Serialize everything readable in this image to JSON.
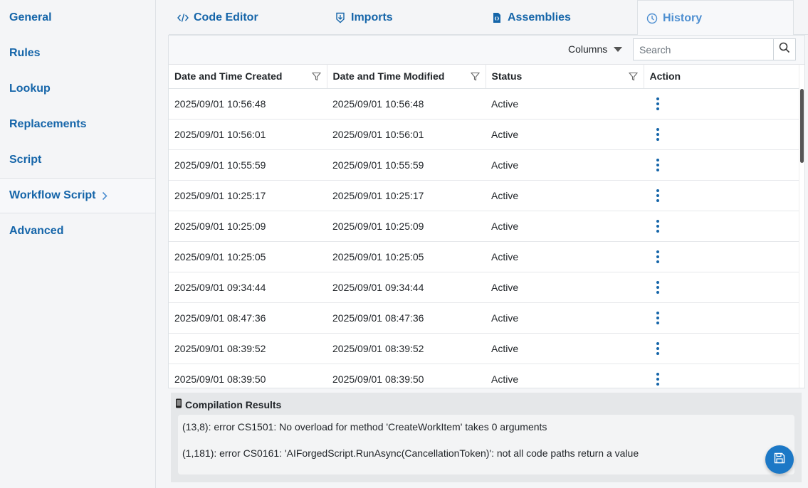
{
  "sidebar": {
    "items": [
      {
        "label": "General"
      },
      {
        "label": "Rules"
      },
      {
        "label": "Lookup"
      },
      {
        "label": "Replacements"
      },
      {
        "label": "Script"
      },
      {
        "label": "Workflow Script",
        "active": true
      },
      {
        "label": "Advanced"
      }
    ]
  },
  "tabs": [
    {
      "label": "Code Editor",
      "icon": "code-icon"
    },
    {
      "label": "Imports",
      "icon": "import-icon"
    },
    {
      "label": "Assemblies",
      "icon": "assembly-icon"
    },
    {
      "label": "History",
      "icon": "history-icon",
      "active": true
    }
  ],
  "toolbar": {
    "columns_label": "Columns",
    "search_placeholder": "Search",
    "search_value": ""
  },
  "table": {
    "headers": [
      "Date and Time Created",
      "Date and Time Modified",
      "Status",
      "Action"
    ],
    "rows": [
      [
        "2025/09/01 10:56:48",
        "2025/09/01 10:56:48",
        "Active"
      ],
      [
        "2025/09/01 10:56:01",
        "2025/09/01 10:56:01",
        "Active"
      ],
      [
        "2025/09/01 10:55:59",
        "2025/09/01 10:55:59",
        "Active"
      ],
      [
        "2025/09/01 10:25:17",
        "2025/09/01 10:25:17",
        "Active"
      ],
      [
        "2025/09/01 10:25:09",
        "2025/09/01 10:25:09",
        "Active"
      ],
      [
        "2025/09/01 10:25:05",
        "2025/09/01 10:25:05",
        "Active"
      ],
      [
        "2025/09/01 09:34:44",
        "2025/09/01 09:34:44",
        "Active"
      ],
      [
        "2025/09/01 08:47:36",
        "2025/09/01 08:47:36",
        "Active"
      ],
      [
        "2025/09/01 08:39:52",
        "2025/09/01 08:39:52",
        "Active"
      ],
      [
        "2025/09/01 08:39:50",
        "2025/09/01 08:39:50",
        "Active"
      ]
    ]
  },
  "compilation": {
    "title": "Compilation Results",
    "icon": "mobile-icon",
    "errors": [
      "(13,8): error CS1501: No overload for method 'CreateWorkItem' takes 0 arguments",
      "(1,181): error CS0161: 'AIForgedScript.RunAsync(CancellationToken)': not all code paths return a value"
    ]
  },
  "fab": {
    "icon": "save-icon"
  },
  "colors": {
    "accent": "#1565a9",
    "tab_active": "#4e8fd1",
    "fab": "#1c78c6"
  }
}
